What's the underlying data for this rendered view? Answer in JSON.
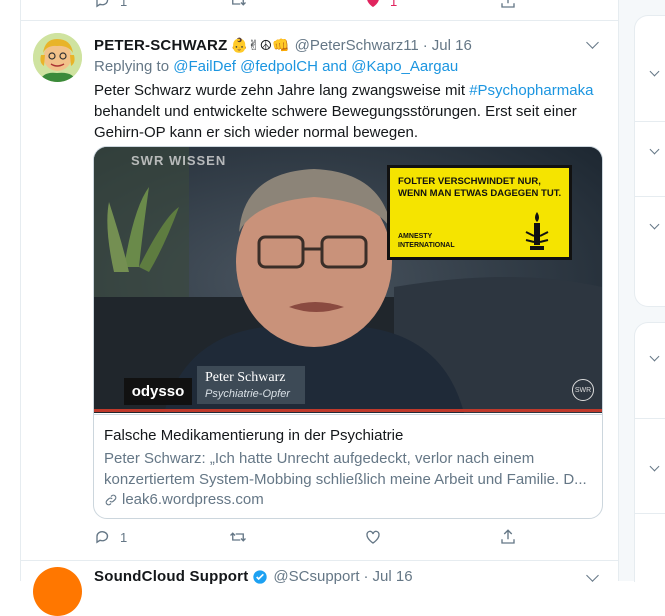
{
  "previous_tweet": {
    "reply_count": "1",
    "like_count": "1"
  },
  "tweet": {
    "display_name": "PETER-SCHWARZ",
    "display_name_emojis": "👶✌☮👊",
    "handle": "@PeterSchwarz11",
    "time": "Jul 16",
    "reply_prefix": "Replying to",
    "reply_to_1": "@FailDef",
    "reply_to_2": "@fedpolCH",
    "reply_and": "and",
    "reply_to_3": "@Kapo_Aargau",
    "text_part1": "Peter Schwarz wurde zehn Jahre lang zwangsweise mit ",
    "hashtag": "#Psychopharmaka",
    "text_part2": " behandelt und entwickelte schwere Bewegungsstörungen. Erst seit einer Gehirn-OP kann er sich wieder normal bewegen.",
    "card": {
      "title": "Falsche Medikamentierung in der Psychiatrie",
      "description": "Peter Schwarz: „Ich hatte Unrecht aufgedeckt, verlor nach einem konzertiertem System-Mobbing schließlich meine Arbeit und Familie. D...",
      "domain": "leak6.wordpress.com",
      "media": {
        "channel_logo": "SWR WISSEN",
        "poster_line1": "FOLTER VERSCHWINDET NUR,",
        "poster_line2": "WENN MAN ETWAS DAGEGEN TUT.",
        "poster_org1": "AMNESTY",
        "poster_org2": "INTERNATIONAL",
        "show_name": "odysso",
        "person_name": "Peter Schwarz",
        "person_role": "Psychiatrie-Opfer",
        "corner_logo": "SWR"
      }
    },
    "reply_count": "1"
  },
  "next_tweet": {
    "display_name": "SoundCloud Support",
    "handle": "@SCsupport",
    "time": "Jul 16"
  },
  "colors": {
    "link": "#1b95e0",
    "secondary_text": "#657786",
    "border": "#e6ecf0",
    "like_active": "#e0245e"
  }
}
